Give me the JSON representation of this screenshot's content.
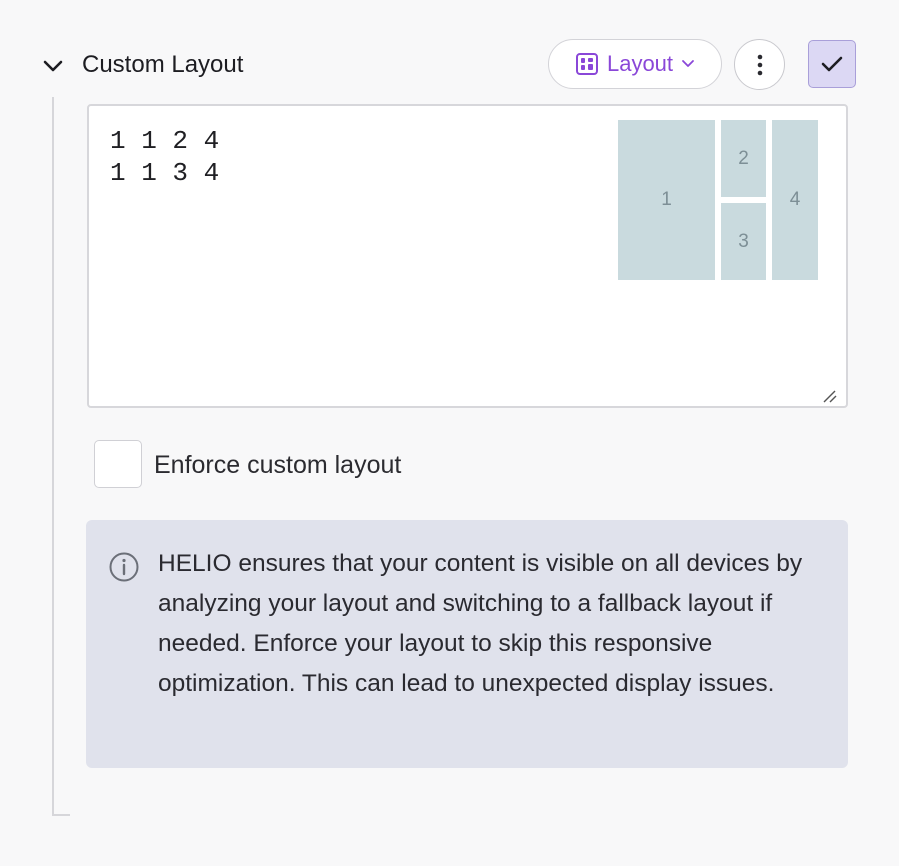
{
  "header": {
    "title": "Custom Layout",
    "collapse_icon": "chevron-down-icon",
    "layout_button": {
      "label": "Layout",
      "icon": "layout-grid-icon",
      "caret_icon": "chevron-down-icon",
      "accent": "#8a47d8"
    },
    "more_button": {
      "icon": "more-vertical-icon"
    },
    "confirm_button": {
      "icon": "checkmark-icon",
      "background": "#dcd8f4"
    }
  },
  "editor": {
    "value": "1 1 2 4\n1 1 3 4",
    "preview": {
      "cells": [
        {
          "label": "1"
        },
        {
          "label": "2"
        },
        {
          "label": "3"
        },
        {
          "label": "4"
        }
      ],
      "color": "#c9dade"
    }
  },
  "enforce": {
    "label": "Enforce custom layout",
    "checked": false
  },
  "info": {
    "icon": "info-icon",
    "text": "HELIO ensures that your content is visible on all devices by analyzing your layout and switching to a fallback layout if needed. Enforce your layout to skip this responsive optimization. This can lead to unexpected display issues."
  }
}
